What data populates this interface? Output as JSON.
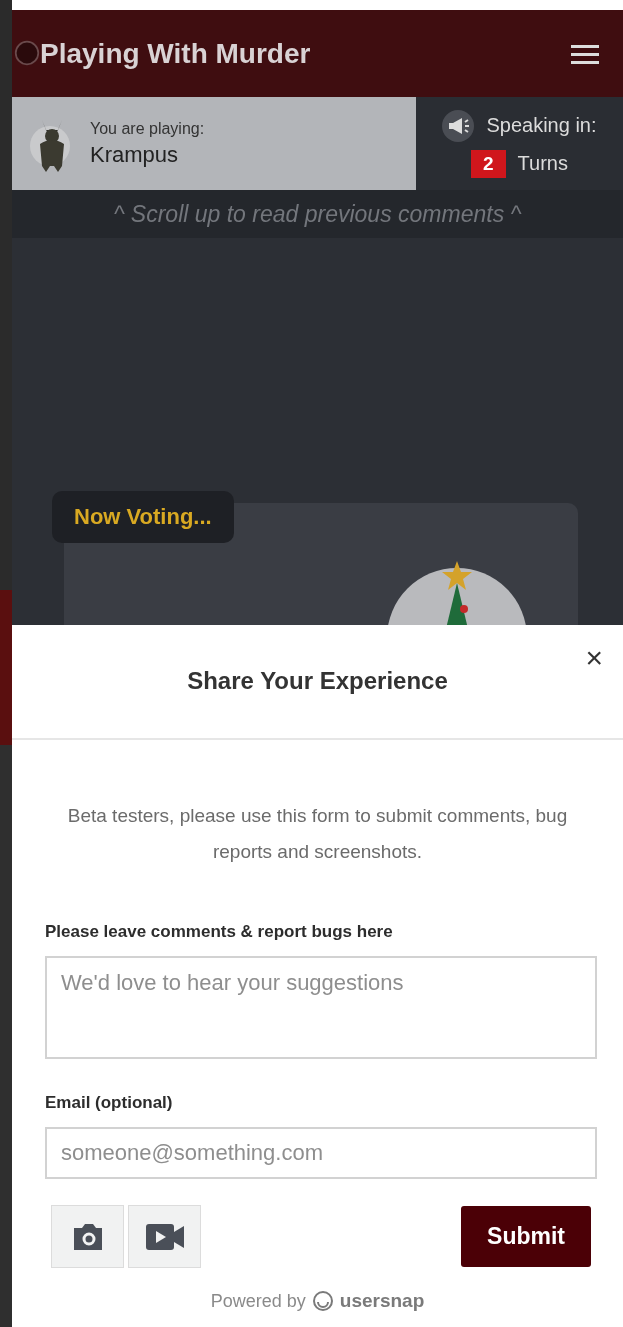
{
  "header": {
    "title": "Playing With Murder"
  },
  "player": {
    "label": "You are playing:",
    "name": "Krampus"
  },
  "speaking": {
    "label": "Speaking in:",
    "count": "2",
    "unit": "Turns"
  },
  "scroll_hint": "^ Scroll up to read previous comments ^",
  "voting": {
    "badge": "Now Voting..."
  },
  "feedback": {
    "title": "Share Your Experience",
    "close": "×",
    "description": "Beta testers, please use this form to submit comments, bug reports and screenshots.",
    "fields": [
      {
        "label": "Please leave comments & report bugs here",
        "placeholder": "We'd love to hear your suggestions",
        "kind": "textarea"
      },
      {
        "label": "Email (optional)",
        "placeholder": "someone@something.com",
        "kind": "input"
      }
    ],
    "submit": "Submit",
    "powered_by": "Powered by",
    "brand": "usersnap"
  }
}
